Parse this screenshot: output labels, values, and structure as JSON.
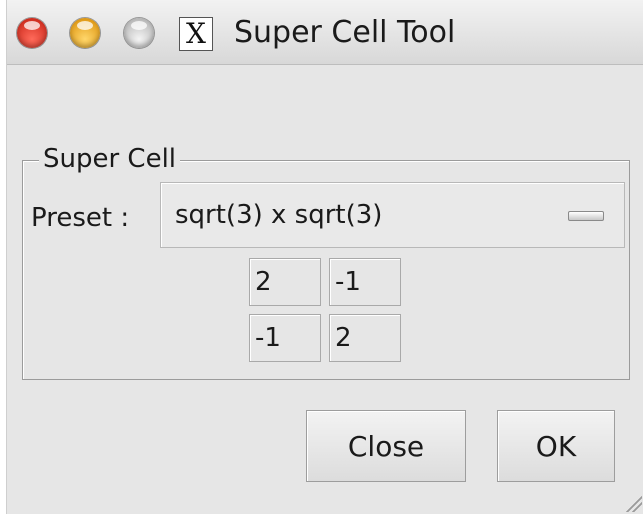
{
  "window": {
    "title": "Super Cell Tool",
    "app_icon_glyph": "X"
  },
  "group": {
    "legend": "Super Cell",
    "preset_label": "Preset :",
    "preset_value": "sqrt(3) x sqrt(3)"
  },
  "matrix": {
    "r0c0": "2",
    "r0c1": "-1",
    "r1c0": "-1",
    "r1c1": "2"
  },
  "buttons": {
    "close_label": "Close",
    "ok_label": "OK"
  },
  "colors": {
    "close_light": "#e0443a",
    "minimize_light": "#f5b92f",
    "zoom_light": "#cfcfcf"
  }
}
